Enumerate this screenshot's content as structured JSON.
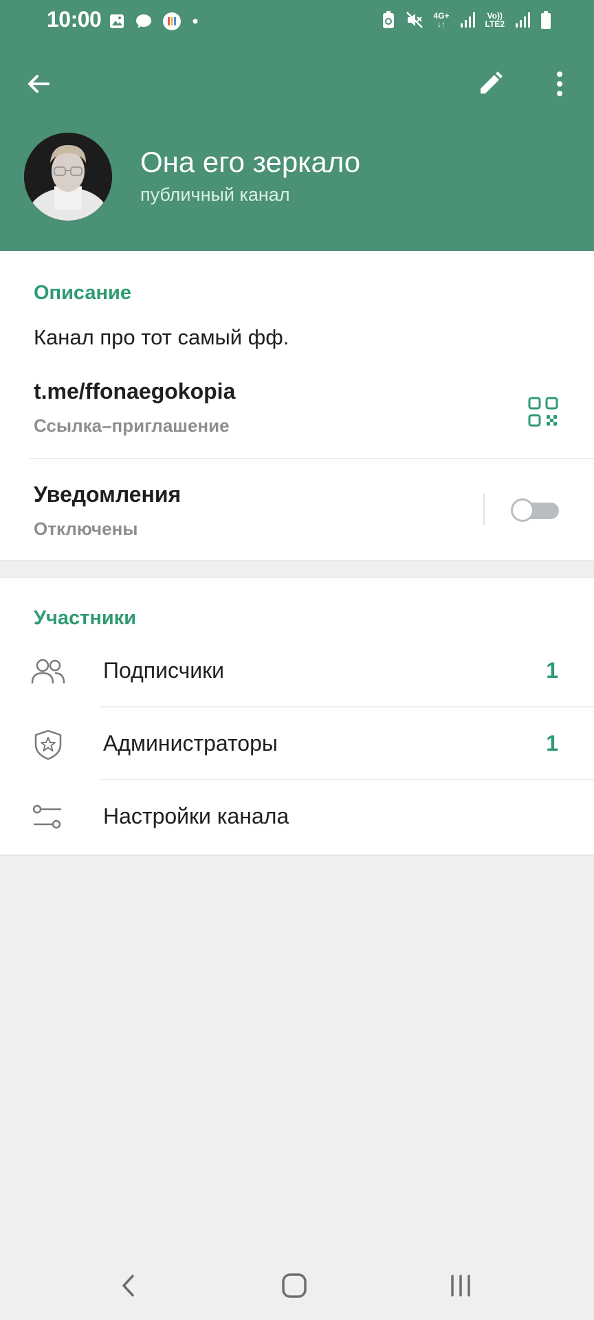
{
  "status_bar": {
    "time": "10:00",
    "network": "4G+",
    "lte_top": "Vo))",
    "lte_bottom": "LTE2"
  },
  "header": {
    "title": "Она его зеркало",
    "subtitle": "публичный канал",
    "icons": {
      "back": "arrow-back-icon",
      "edit": "pencil-icon",
      "menu": "more-vertical-icon"
    }
  },
  "description_section": {
    "heading": "Описание",
    "text": "Канал про тот самый фф.",
    "link": "t.me/ffonaegokopia",
    "link_caption": "Ссылка–приглашение",
    "notifications_label": "Уведомления",
    "notifications_state": "Отключены",
    "notifications_enabled": false
  },
  "members_section": {
    "heading": "Участники",
    "rows": [
      {
        "label": "Подписчики",
        "count": "1",
        "icon": "people-icon"
      },
      {
        "label": "Администраторы",
        "count": "1",
        "icon": "shield-star-icon"
      },
      {
        "label": "Настройки канала",
        "count": "",
        "icon": "sliders-icon"
      }
    ]
  },
  "colors": {
    "header": "#4a9176",
    "accent": "#2f9b72",
    "background": "#efeef1"
  }
}
